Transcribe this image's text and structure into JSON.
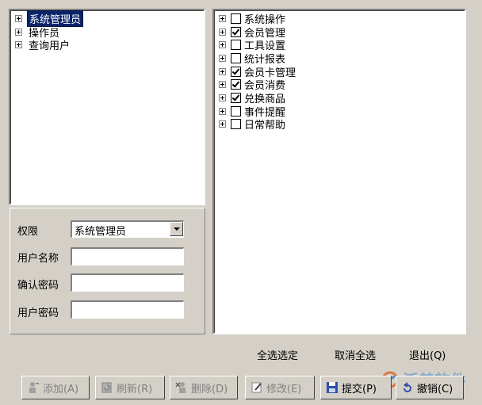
{
  "roles_tree": {
    "items": [
      {
        "label": "系统管理员",
        "selected": true
      },
      {
        "label": "操作员",
        "selected": false
      },
      {
        "label": "查询用户",
        "selected": false
      }
    ]
  },
  "permissions_tree": {
    "items": [
      {
        "label": "系统操作",
        "checked": false
      },
      {
        "label": "会员管理",
        "checked": true
      },
      {
        "label": "工具设置",
        "checked": false
      },
      {
        "label": "统计报表",
        "checked": false
      },
      {
        "label": "会员卡管理",
        "checked": true
      },
      {
        "label": "会员消费",
        "checked": true
      },
      {
        "label": "兑换商品",
        "checked": true
      },
      {
        "label": "事件提醒",
        "checked": false
      },
      {
        "label": "日常帮助",
        "checked": false
      }
    ]
  },
  "form": {
    "permission_label": "权限",
    "permission_value": "系统管理员",
    "username_label": "用户名称",
    "username_value": "",
    "confirm_password_label": "确认密码",
    "confirm_password_value": "",
    "password_label": "用户密码",
    "password_value": ""
  },
  "selection_actions": {
    "select_all": "全选选定",
    "deselect_all": "取消全选",
    "exit": "退出(Q)"
  },
  "toolbar": {
    "add": "添加(A)",
    "refresh": "刷新(R)",
    "delete": "删除(D)",
    "modify": "修改(E)",
    "submit": "提交(P)",
    "cancel": "撤销(C)"
  },
  "watermark": {
    "text": "泛普软件"
  }
}
